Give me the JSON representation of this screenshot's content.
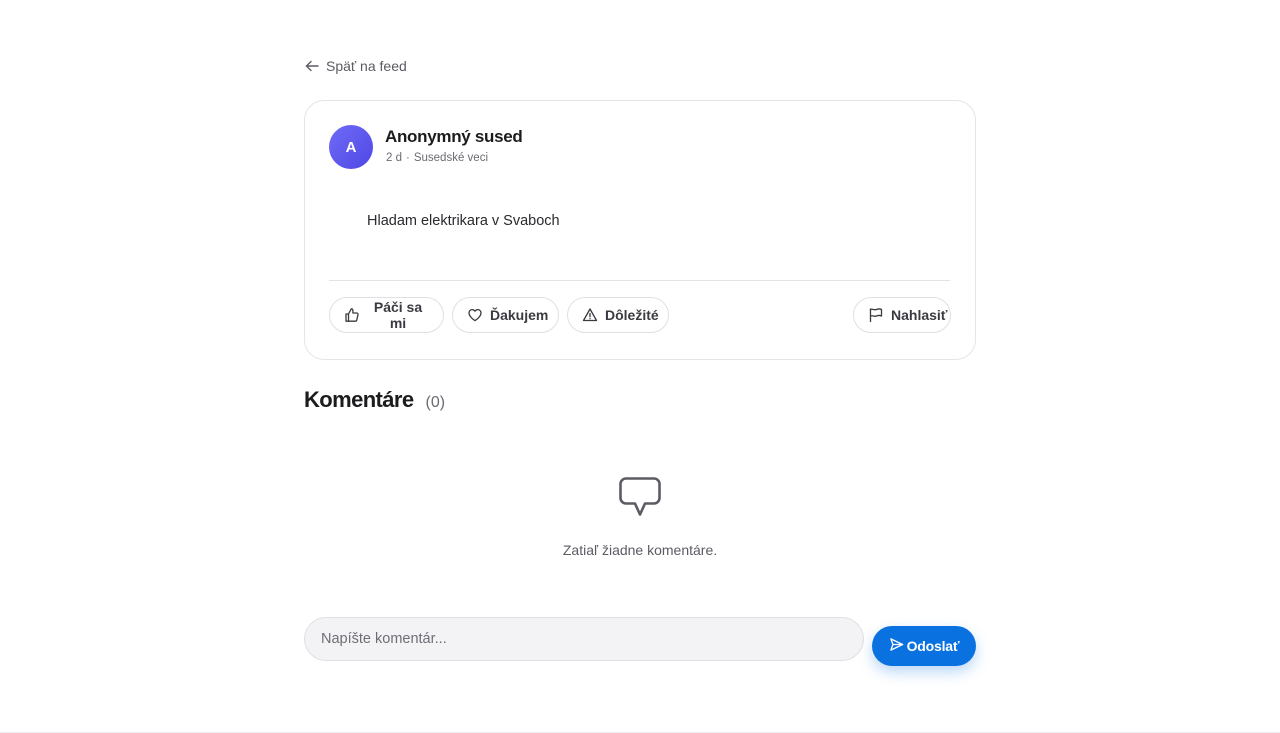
{
  "nav": {
    "back_label": "Späť na feed"
  },
  "post": {
    "avatar_initial": "A",
    "author": "Anonymný sused",
    "age": "2 d",
    "separator": "·",
    "category": "Susedské veci",
    "body": "Hladam elektrikara v Svaboch",
    "actions": {
      "like": "Páči sa mi",
      "thanks": "Ďakujem",
      "important": "Dôležité",
      "report": "Nahlasiť"
    }
  },
  "comments": {
    "title": "Komentáre",
    "count": "(0)",
    "empty_text": "Zatiaľ žiadne komentáre.",
    "input_placeholder": "Napíšte komentár...",
    "send_label": "Odoslať"
  },
  "colors": {
    "accent": "#0a72e0",
    "avatar": "#5b57ee"
  },
  "icons": {
    "back": "arrow-left-icon",
    "like": "thumbs-up-icon",
    "thanks": "heart-icon",
    "important": "warning-triangle-icon",
    "report": "flag-icon",
    "empty": "speech-bubble-icon",
    "send": "send-icon"
  }
}
